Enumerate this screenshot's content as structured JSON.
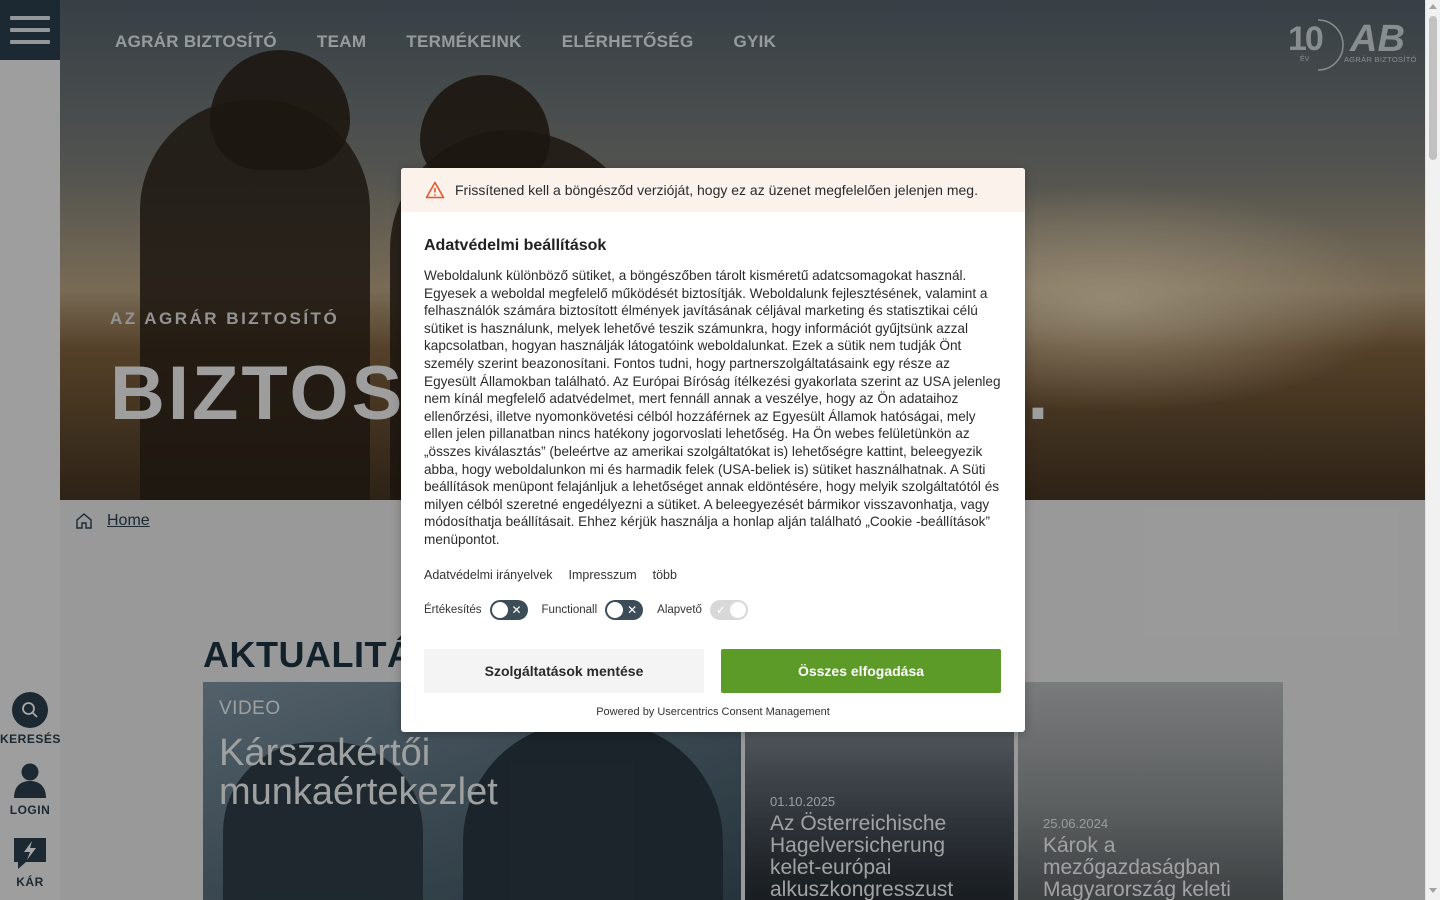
{
  "nav": {
    "items": [
      "AGRÁR BIZTOSÍTÓ",
      "TEAM",
      "TERMÉKEINK",
      "ELÉRHETŐSÉG",
      "GYIK"
    ]
  },
  "logo": {
    "years": "10",
    "years_label": "ÉV",
    "brand": "AB",
    "subtitle": "AGRÁR BIZTOSÍTÓ"
  },
  "hero": {
    "kicker": "AZ AGRÁR BIZTOSÍTÓ",
    "title": "BIZTOSÍT",
    "title_tail": "L."
  },
  "sidebar": {
    "search_label": "KERESÉS",
    "login_label": "LOGIN",
    "claim_label": "KÁR"
  },
  "breadcrumb": {
    "home": "Home"
  },
  "news": {
    "heading": "AKTUALITÁS",
    "main_tag": "VIDEO",
    "main_title": "Kárszakértői munkaértekezlet",
    "cards": [
      {
        "date": "01.10.2025",
        "title": "Az Österreichische Hagelversicherung kelet-európai alkuszkongresszust"
      },
      {
        "date": "25.06.2024",
        "title": "Károk a mezőgazdaságban Magyarország keleti"
      }
    ]
  },
  "consent": {
    "warning": "Frissítened kell a böngésződ verzióját, hogy ez az üzenet megfelelően jelenjen meg.",
    "title": "Adatvédelmi beállítások",
    "body": "Weboldalunk különböző sütiket, a böngészőben tárolt kisméretű adatcsomagokat használ. Egyesek a weboldal megfelelő működését biztosítják. Weboldalunk fejlesztésének, valamint a felhasználók számára biztosított élmények javításának céljával marketing és statisztikai célú sütiket is használunk, melyek lehetővé teszik számunkra, hogy információt gyűjtsünk azzal kapcsolatban, hogyan használják látogatóink weboldalunkat. Ezek a sütik nem tudják Önt személy szerint beazonosítani. Fontos tudni, hogy partnerszolgáltatásaink egy része az Egyesült Államokban található. Az Európai Bíróság ítélkezési gyakorlata szerint az USA jelenleg nem kínál megfelelő adatvédelmet, mert fennáll annak a veszélye, hogy az Ön adataihoz ellenőrzési, illetve nyomonkövetési célból hozzáférnek az Egyesült Államok hatóságai, mely ellen jelen pillanatban nincs hatékony jogorvoslati lehetőség. Ha Ön webes felületünkön az „összes kiválasztás” (beleértve az amerikai szolgáltatókat is) lehetőségre kattint, beleegyezik abba, hogy weboldalunkon mi és harmadik felek (USA-beliek is) sütiket használhatnak. A Süti beállítások menüpont felajánljuk a lehetőséget annak eldöntésére, hogy melyik szolgáltatótól és milyen célból szeretné engedélyezni a sütiket. A beleegyezését bármikor visszavonhatja, vagy módosíthatja beállításait. Ehhez kérjük használja a honlap alján található „Cookie -beállítások” menüpontot.",
    "links": [
      "Adatvédelmi irányelvek",
      "Impresszum",
      "több"
    ],
    "toggles": [
      {
        "label": "Értékesítés",
        "on": false
      },
      {
        "label": "Functionall",
        "on": false
      },
      {
        "label": "Alapvető",
        "on": true
      }
    ],
    "save_label": "Szolgáltatások mentése",
    "accept_label": "Összes elfogadása",
    "powered": "Powered by Usercentrics Consent Management"
  },
  "colors": {
    "nav_dark": "#2c3f4c",
    "accept_green": "#5c9b28",
    "warning_bg": "#fcf2ec",
    "warning_icon": "#e4572e"
  }
}
